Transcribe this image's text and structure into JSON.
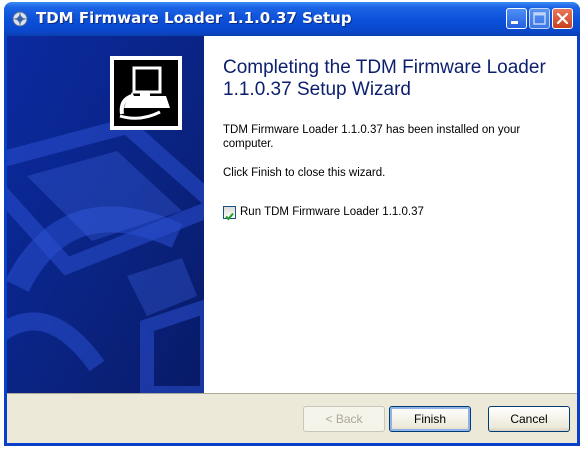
{
  "window": {
    "title": "TDM Firmware Loader 1.1.0.37 Setup"
  },
  "wizard": {
    "heading": "Completing the TDM Firmware Loader 1.1.0.37 Setup Wizard",
    "description": "TDM Firmware Loader 1.1.0.37 has been installed on your computer.",
    "instruction": "Click Finish to close this wizard.",
    "run_checkbox": {
      "label": "Run TDM Firmware Loader 1.1.0.37",
      "checked": true
    }
  },
  "buttons": {
    "back": "< Back",
    "finish": "Finish",
    "cancel": "Cancel"
  },
  "colors": {
    "titlebar": "#0a48cc",
    "sidebar": "#0a2a9a",
    "footer": "#ece9d8",
    "heading": "#0b1f6e"
  },
  "icons": {
    "title": "installer-icon",
    "logo": "computer-install-icon"
  }
}
